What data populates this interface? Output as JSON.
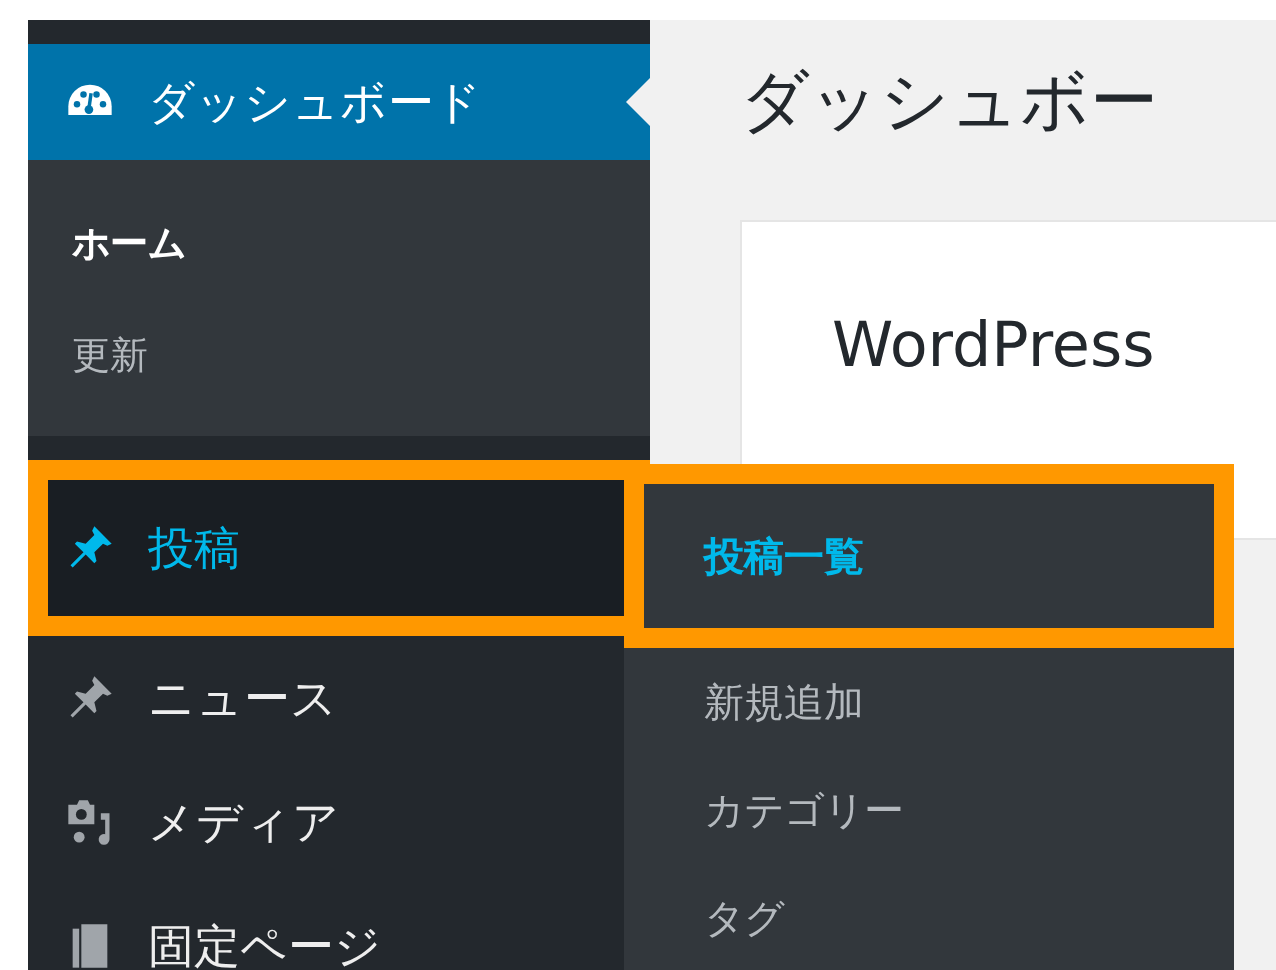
{
  "sidebar": {
    "items": [
      {
        "label": "ダッシュボード",
        "kind": "gauge",
        "selected": true,
        "submenu": [
          {
            "label": "ホーム",
            "selected": true
          },
          {
            "label": "更新",
            "selected": false
          }
        ]
      },
      {
        "label": "投稿",
        "kind": "pin",
        "selected": false,
        "hover": true,
        "highlighted": true
      },
      {
        "label": "ニュース",
        "kind": "pin",
        "selected": false,
        "hover": false,
        "highlighted": false
      },
      {
        "label": "メディア",
        "kind": "media",
        "selected": false,
        "hover": false,
        "highlighted": false
      },
      {
        "label": "固定ページ",
        "kind": "page",
        "selected": false,
        "hover": false,
        "highlighted": false
      }
    ]
  },
  "flyout": {
    "items": [
      {
        "label": "投稿一覧",
        "selected": true,
        "highlighted": true
      },
      {
        "label": "新規追加",
        "selected": false,
        "highlighted": false
      },
      {
        "label": "カテゴリー",
        "selected": false,
        "highlighted": false
      },
      {
        "label": "タグ",
        "selected": false,
        "highlighted": false
      }
    ]
  },
  "main": {
    "title": "ダッシュボー",
    "welcome_heading": "WordPress"
  }
}
